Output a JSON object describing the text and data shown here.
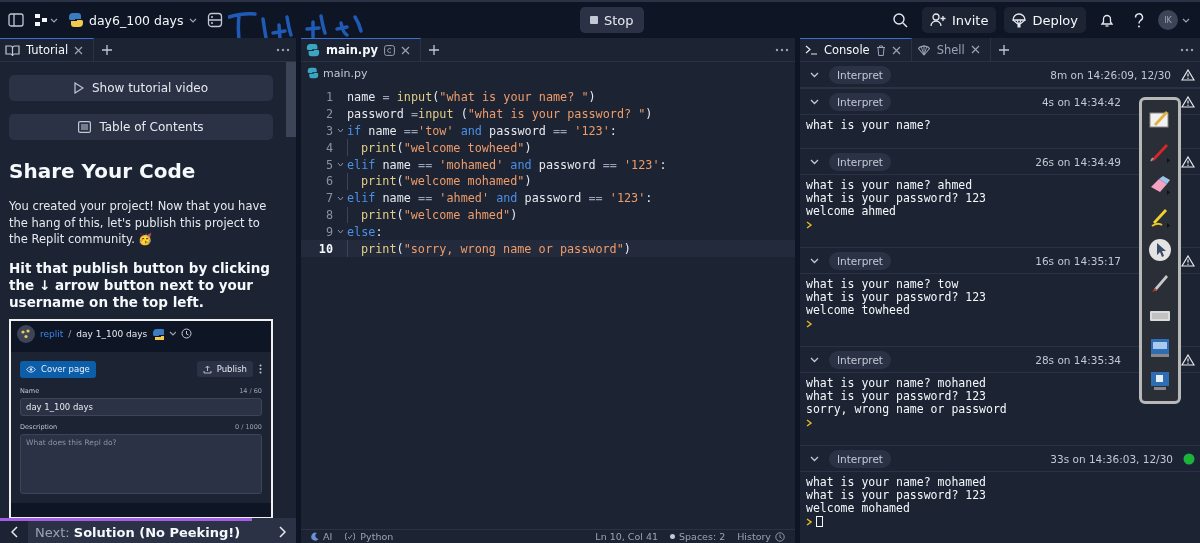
{
  "top_bar": {
    "project_name": "day6_100 days",
    "stop_button": "Stop",
    "invite_button": "Invite",
    "deploy_button": "Deploy",
    "avatar": "IK"
  },
  "left_panel": {
    "tab": {
      "label": "Tutorial",
      "selected": true
    },
    "buttons": [
      "Show tutorial video",
      "Table of Contents"
    ],
    "heading": "Share Your Code",
    "paragraph": "You created your project! Now that you have the hang of this, let's publish this project to the Replit community. 🥳",
    "instruction": "Hit that publish button by clicking the ↓ arrow button next to your username on the top left.",
    "embedded_screenshot": {
      "owner": "replit",
      "separator": "/",
      "project": "day 1_100 days",
      "cover_page_button": "Cover page",
      "publish_button": "Publish",
      "name_label": "Name",
      "name_count": "14 / 60",
      "name_value": "day 1_100 days",
      "description_label": "Description",
      "description_count": "0 / 1000",
      "description_placeholder": "What does this Repl do?"
    },
    "progress": {
      "level": 0.85
    },
    "next": {
      "prefix": "Next:",
      "title": "Solution (No Peeking!)"
    }
  },
  "editor": {
    "tab": {
      "label": "main.py",
      "selected": true
    },
    "breadcrumb": "main.py",
    "lines": [
      {
        "number": "1",
        "foldable": false,
        "indent": false,
        "active": false,
        "tokens": [
          {
            "kind": "var",
            "t": "name "
          },
          {
            "kind": "op",
            "t": "= "
          },
          {
            "kind": "fn",
            "t": "input"
          },
          {
            "kind": "punc",
            "t": "("
          },
          {
            "kind": "str",
            "t": "\"what is your name? \""
          },
          {
            "kind": "punc",
            "t": ")"
          }
        ]
      },
      {
        "number": "2",
        "foldable": false,
        "indent": false,
        "active": false,
        "tokens": [
          {
            "kind": "var",
            "t": "password "
          },
          {
            "kind": "op",
            "t": "="
          },
          {
            "kind": "fn",
            "t": "input "
          },
          {
            "kind": "punc",
            "t": "("
          },
          {
            "kind": "str",
            "t": "\"what is your password? \""
          },
          {
            "kind": "punc",
            "t": ")"
          }
        ]
      },
      {
        "number": "3",
        "foldable": true,
        "indent": false,
        "active": false,
        "tokens": [
          {
            "kind": "kw",
            "t": "if "
          },
          {
            "kind": "var",
            "t": "name "
          },
          {
            "kind": "op",
            "t": "=="
          },
          {
            "kind": "str",
            "t": "'tow'"
          },
          {
            "kind": "kw",
            "t": " and "
          },
          {
            "kind": "var",
            "t": "password "
          },
          {
            "kind": "op",
            "t": "== "
          },
          {
            "kind": "str",
            "t": "'123'"
          },
          {
            "kind": "punc",
            "t": ":"
          }
        ]
      },
      {
        "number": "4",
        "foldable": false,
        "indent": true,
        "active": false,
        "tokens": [
          {
            "kind": "fn",
            "t": "print"
          },
          {
            "kind": "punc",
            "t": "("
          },
          {
            "kind": "str",
            "t": "\"welcome towheed\""
          },
          {
            "kind": "punc",
            "t": ")"
          }
        ]
      },
      {
        "number": "5",
        "foldable": true,
        "indent": false,
        "active": false,
        "tokens": [
          {
            "kind": "kw",
            "t": "elif "
          },
          {
            "kind": "var",
            "t": "name "
          },
          {
            "kind": "op",
            "t": "== "
          },
          {
            "kind": "str",
            "t": "'mohamed'"
          },
          {
            "kind": "kw",
            "t": " and "
          },
          {
            "kind": "var",
            "t": "password "
          },
          {
            "kind": "op",
            "t": "== "
          },
          {
            "kind": "str",
            "t": "'123'"
          },
          {
            "kind": "punc",
            "t": ":"
          }
        ]
      },
      {
        "number": "6",
        "foldable": false,
        "indent": true,
        "active": false,
        "tokens": [
          {
            "kind": "fn",
            "t": "print"
          },
          {
            "kind": "punc",
            "t": "("
          },
          {
            "kind": "str",
            "t": "\"welcome mohamed\""
          },
          {
            "kind": "punc",
            "t": ")"
          }
        ]
      },
      {
        "number": "7",
        "foldable": true,
        "indent": false,
        "active": false,
        "tokens": [
          {
            "kind": "kw",
            "t": "elif "
          },
          {
            "kind": "var",
            "t": "name "
          },
          {
            "kind": "op",
            "t": "== "
          },
          {
            "kind": "str",
            "t": "'ahmed'"
          },
          {
            "kind": "kw",
            "t": " and "
          },
          {
            "kind": "var",
            "t": "password "
          },
          {
            "kind": "op",
            "t": "== "
          },
          {
            "kind": "str",
            "t": "'123'"
          },
          {
            "kind": "punc",
            "t": ":"
          }
        ]
      },
      {
        "number": "8",
        "foldable": false,
        "indent": true,
        "active": false,
        "tokens": [
          {
            "kind": "fn",
            "t": "print"
          },
          {
            "kind": "punc",
            "t": "("
          },
          {
            "kind": "str",
            "t": "\"welcome ahmed\""
          },
          {
            "kind": "punc",
            "t": ")"
          }
        ]
      },
      {
        "number": "9",
        "foldable": true,
        "indent": false,
        "active": false,
        "tokens": [
          {
            "kind": "kw",
            "t": "else"
          },
          {
            "kind": "punc",
            "t": ":"
          }
        ]
      },
      {
        "number": "10",
        "foldable": false,
        "indent": true,
        "active": true,
        "tokens": [
          {
            "kind": "fn",
            "t": "print"
          },
          {
            "kind": "punc",
            "t": "("
          },
          {
            "kind": "str",
            "t": "\"sorry, wrong name or password\""
          },
          {
            "kind": "punc",
            "t": ")"
          }
        ]
      }
    ],
    "status_bar": {
      "ai": "AI",
      "language": "Python",
      "position": "Ln 10, Col 41",
      "spaces": "Spaces: 2",
      "history": "History"
    }
  },
  "console": {
    "tabs": [
      {
        "label": "Console",
        "selected": true
      },
      {
        "label": "Shell",
        "selected": false
      }
    ],
    "runs": [
      {
        "label": "Interpret",
        "time": "8m on 14:26:09, 12/30",
        "kind": "warning",
        "under_toolbar": false,
        "prompt": false,
        "cursor": false
      },
      {
        "label": "Interpret",
        "time": "4s on 14:34:42",
        "kind": "warning",
        "under_toolbar": true,
        "output": [
          "what is your name?"
        ],
        "prompt": false,
        "cursor": false
      },
      {
        "label": "Interpret",
        "time": "26s on 14:34:49",
        "kind": "warning",
        "under_toolbar": true,
        "output": [
          "what is your name? ahmed",
          "what is your password? 123",
          "welcome ahmed"
        ],
        "prompt": true,
        "cursor": false
      },
      {
        "label": "Interpret",
        "time": "16s on 14:35:17",
        "kind": "warning",
        "under_toolbar": true,
        "output": [
          "what is your name? tow",
          "what is your password? 123",
          "welcome towheed"
        ],
        "prompt": true,
        "cursor": false
      },
      {
        "label": "Interpret",
        "time": "28s on 14:35:34",
        "kind": "warning",
        "under_toolbar": true,
        "output": [
          "what is your name? mohaned",
          "what is your password? 123",
          "sorry, wrong name or password"
        ],
        "prompt": true,
        "cursor": false
      },
      {
        "label": "Interpret",
        "time": "33s on 14:36:03, 12/30",
        "kind": "success",
        "under_toolbar": false,
        "output": [
          "what is your name? mohamed",
          "what is your password? 123",
          "welcome mohamed"
        ],
        "prompt": true,
        "cursor": true
      }
    ]
  }
}
